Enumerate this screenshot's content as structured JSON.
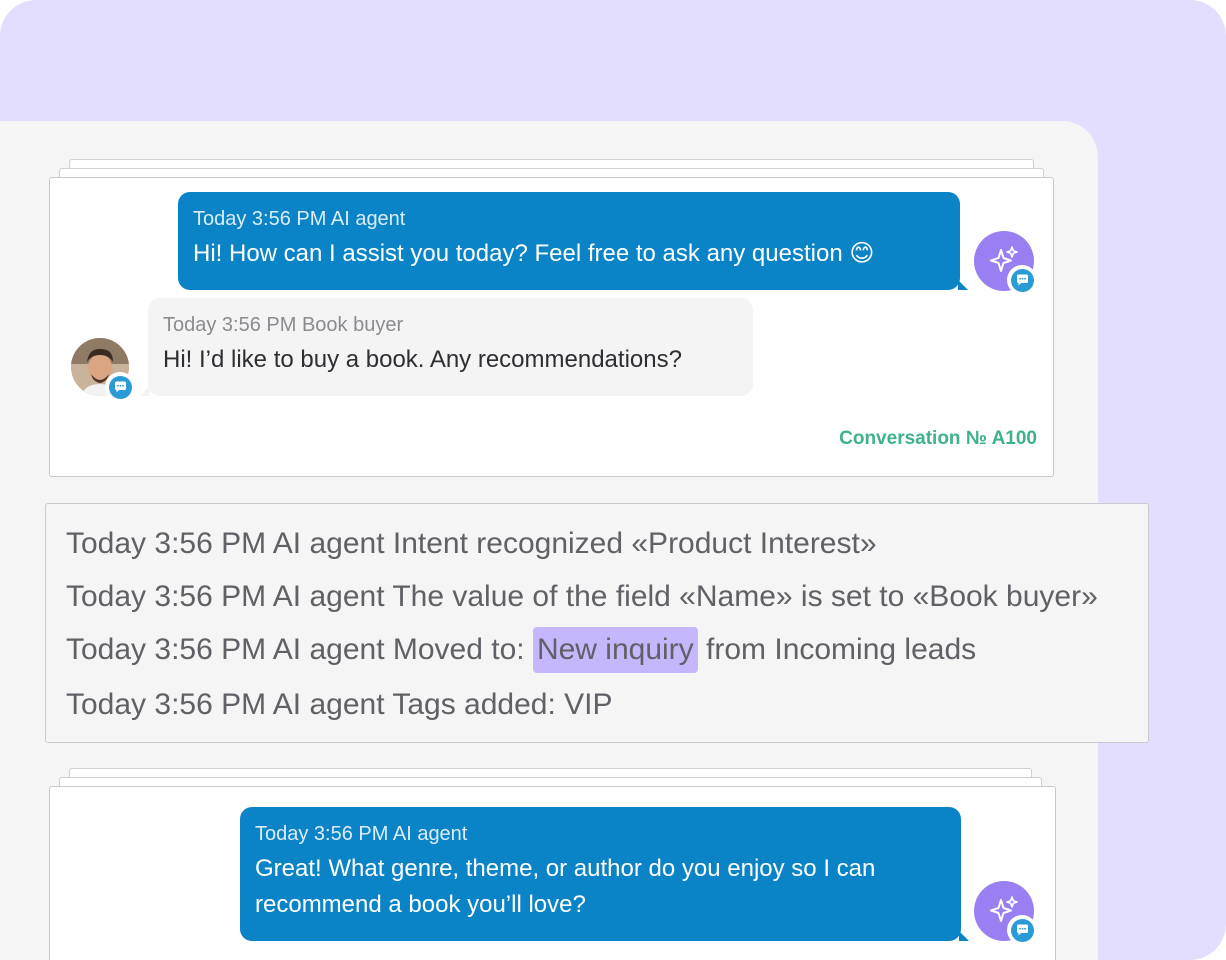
{
  "top_conversation": {
    "agent_message": {
      "meta": "Today 3:56 PM AI agent",
      "text": "Hi! How can I assist you today? Feel free to ask any question 😊"
    },
    "user_message": {
      "meta": "Today 3:56 PM Book buyer",
      "text": "Hi! I’d like to buy a book. Any recommendations?"
    },
    "conversation_number": "Conversation № A100"
  },
  "activity_log": {
    "line1": "Today 3:56 PM AI agent Intent recognized «Product Interest»",
    "line2": "Today 3:56 PM AI agent The value of the field «Name» is set to «Book buyer»",
    "line3_prefix": "Today 3:56 PM AI agent Moved to: ",
    "line3_stage": "New inquiry",
    "line3_suffix": " from Incoming leads",
    "line4": "Today 3:56 PM AI agent Tags added: VIP"
  },
  "bottom_conversation": {
    "agent_message": {
      "meta": "Today 3:56 PM AI agent",
      "text_line1": "Great! What genre, theme, or author do you enjoy so I can",
      "text_line2": "recommend a book you’ll love?"
    }
  },
  "colors": {
    "background_purple": "#e3defe",
    "panel_gray": "#f5f5f5",
    "agent_bubble": "#0a84c6",
    "ai_avatar": "#9a7ff2",
    "conversation_number": "#3fb28a",
    "stage_highlight": "#c6b6fb"
  },
  "icons": {
    "ai_avatar": "sparkles-icon",
    "chat_channel": "chat-bubble-icon"
  }
}
